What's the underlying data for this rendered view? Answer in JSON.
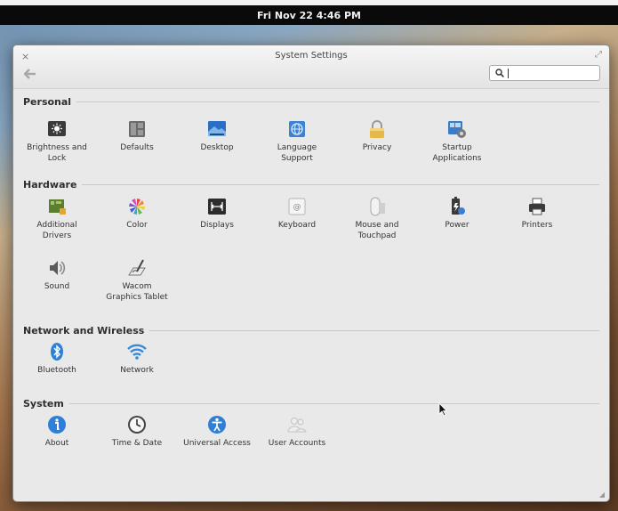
{
  "topbar": {
    "clock": "Fri Nov 22  4:46 PM"
  },
  "window": {
    "title": "System Settings",
    "close_glyph": "×",
    "maximize_glyph": "⤢",
    "back_glyph": "🡐",
    "search": {
      "value": "",
      "placeholder": ""
    }
  },
  "sections": {
    "personal": {
      "title": "Personal",
      "items": [
        {
          "label": "Brightness and\nLock",
          "icon": "brightness-lock-icon"
        },
        {
          "label": "Defaults",
          "icon": "defaults-icon"
        },
        {
          "label": "Desktop",
          "icon": "desktop-icon"
        },
        {
          "label": "Language\nSupport",
          "icon": "language-support-icon"
        },
        {
          "label": "Privacy",
          "icon": "privacy-lock-icon"
        },
        {
          "label": "Startup\nApplications",
          "icon": "startup-applications-icon"
        }
      ]
    },
    "hardware": {
      "title": "Hardware",
      "items": [
        {
          "label": "Additional\nDrivers",
          "icon": "additional-drivers-icon"
        },
        {
          "label": "Color",
          "icon": "color-icon"
        },
        {
          "label": "Displays",
          "icon": "displays-icon"
        },
        {
          "label": "Keyboard",
          "icon": "keyboard-icon"
        },
        {
          "label": "Mouse and\nTouchpad",
          "icon": "mouse-icon"
        },
        {
          "label": "Power",
          "icon": "power-icon"
        },
        {
          "label": "Printers",
          "icon": "printer-icon"
        },
        {
          "label": "Sound",
          "icon": "sound-icon"
        },
        {
          "label": "Wacom\nGraphics Tablet",
          "icon": "wacom-tablet-icon"
        }
      ]
    },
    "network": {
      "title": "Network and Wireless",
      "items": [
        {
          "label": "Bluetooth",
          "icon": "bluetooth-icon"
        },
        {
          "label": "Network",
          "icon": "network-wifi-icon"
        }
      ]
    },
    "system": {
      "title": "System",
      "items": [
        {
          "label": "About",
          "icon": "about-info-icon"
        },
        {
          "label": "Time & Date",
          "icon": "clock-icon"
        },
        {
          "label": "Universal Access",
          "icon": "universal-access-icon"
        },
        {
          "label": "User Accounts",
          "icon": "user-accounts-icon"
        }
      ]
    }
  },
  "colors": {
    "accent_blue": "#2f7fd6",
    "window_bg": "#e9e9e9",
    "topbar_bg": "#0a0a0a"
  }
}
